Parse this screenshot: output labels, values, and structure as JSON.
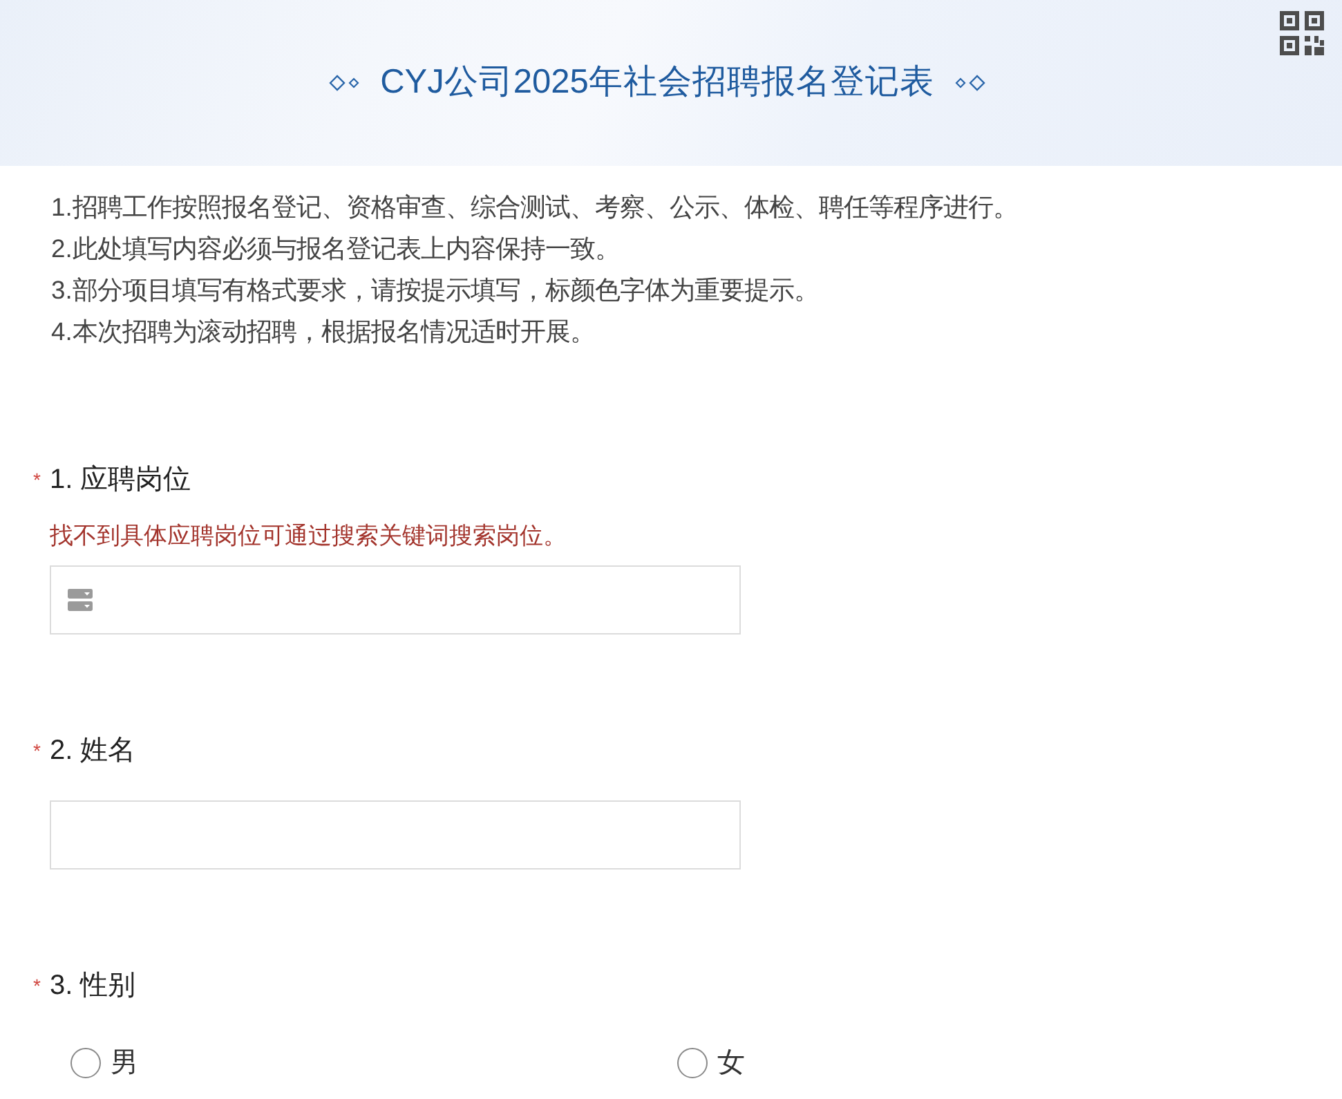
{
  "header": {
    "title": "CYJ公司2025年社会招聘报名登记表"
  },
  "notes": [
    "1.招聘工作按照报名登记、资格审查、综合测试、考察、公示、体检、聘任等程序进行。",
    "2.此处填写内容必须与报名登记表上内容保持一致。",
    "3.部分项目填写有格式要求，请按提示填写，标颜色字体为重要提示。",
    "4.本次招聘为滚动招聘，根据报名情况适时开展。"
  ],
  "questions": [
    {
      "kind": "select",
      "required_mark": "*",
      "label": "1. 应聘岗位",
      "hint": "找不到具体应聘岗位可通过搜索关键词搜索岗位。"
    },
    {
      "kind": "text",
      "required_mark": "*",
      "label": "2. 姓名"
    },
    {
      "kind": "radio",
      "required_mark": "*",
      "label": "3. 性别",
      "options": [
        {
          "label": "男",
          "selected": false
        },
        {
          "label": "女",
          "selected": false
        }
      ]
    }
  ]
}
